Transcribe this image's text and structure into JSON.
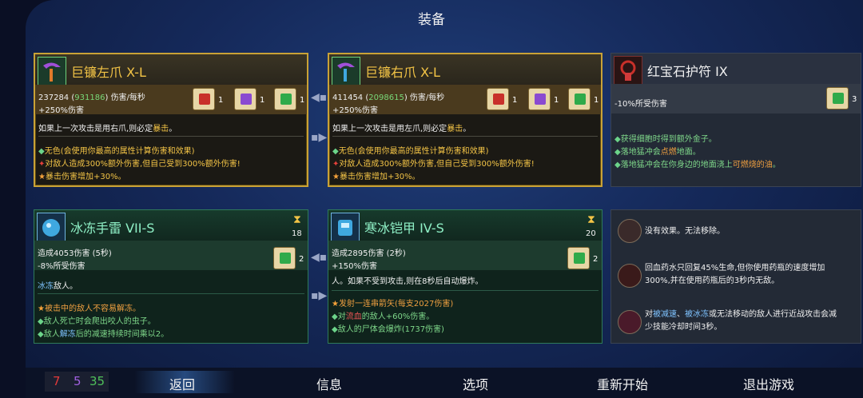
{
  "header": {
    "title": "装备"
  },
  "weapons": [
    {
      "name": "巨镰左爪 X-L",
      "dps": "237284",
      "dps_alt": "931186",
      "dps_unit": "伤害/每秒",
      "bonus": "+250%伤害",
      "scrolls": [
        {
          "icon": "brutality-scroll-icon",
          "count": "1",
          "color": "#c8302a"
        },
        {
          "icon": "tactics-scroll-icon",
          "count": "1",
          "color": "#8a4ad0"
        },
        {
          "icon": "survival-scroll-icon",
          "count": "1",
          "color": "#2faa4a"
        }
      ],
      "effect_prefix": "如果上一次攻击是用右爪,则必定",
      "effect_keyword": "暴击",
      "effect_suffix": "。",
      "affixes": [
        "无色(会使用你最高的属性计算伤害和效果)",
        "对敌人造成300%额外伤害,但自己受到300%额外伤害!",
        "暴击伤害增加+30%。"
      ]
    },
    {
      "name": "巨镰右爪 X-L",
      "dps": "411454",
      "dps_alt": "2098615",
      "dps_unit": "伤害/每秒",
      "bonus": "+250%伤害",
      "scrolls": [
        {
          "icon": "brutality-scroll-icon",
          "count": "1",
          "color": "#c8302a"
        },
        {
          "icon": "tactics-scroll-icon",
          "count": "1",
          "color": "#8a4ad0"
        },
        {
          "icon": "survival-scroll-icon",
          "count": "1",
          "color": "#2faa4a"
        }
      ],
      "effect_prefix": "如果上一次攻击是用左爪,则必定",
      "effect_keyword": "暴击",
      "effect_suffix": "。",
      "affixes": [
        "无色(会使用你最高的属性计算伤害和效果)",
        "对敌人造成300%额外伤害,但自己受到300%额外伤害!",
        "暴击伤害增加+30%。"
      ]
    }
  ],
  "amulet": {
    "name": "红宝石护符 IX",
    "stat": "-10%所受伤害",
    "scroll": {
      "icon": "survival-scroll-icon",
      "count": "3",
      "color": "#2faa4a"
    },
    "bullets": [
      {
        "a": "获得细胞时得到额外金子。"
      },
      {
        "a": "落地猛冲会",
        "b": "点燃",
        "c": "地面。"
      },
      {
        "a": "落地猛冲会在你身边的地面浇上",
        "b": "可燃烧的油",
        "c": "。"
      }
    ]
  },
  "skills": [
    {
      "name": "冰冻手雷 VII-S",
      "cooldown": "18",
      "stat1": "造成4053伤害 (5秒)",
      "stat2": "-8%所受伤害",
      "scroll": {
        "icon": "survival-scroll-icon",
        "count": "2",
        "color": "#2faa4a"
      },
      "effect_keyword": "冰冻",
      "effect_suffix": "敌人。",
      "affixes": [
        {
          "a": "被击中的敌人不容易解冻。"
        },
        {
          "a": "敌人死亡时会爬出咬人的虫子。"
        },
        {
          "a": "敌人",
          "b": "解冻",
          "c": "后的减速持续时间乘以2。"
        }
      ]
    },
    {
      "name": "寒冰铠甲 IV-S",
      "cooldown": "20",
      "stat1": "造成2895伤害 (2秒)",
      "stat2": "+150%伤害",
      "scroll": {
        "icon": "survival-scroll-icon",
        "count": "2",
        "color": "#2faa4a"
      },
      "effect_text": "人。如果不受到攻击,则在8秒后自动爆炸。",
      "affixes": [
        {
          "a": "发射一连串箭矢(每支2027伤害)"
        },
        {
          "a": "对",
          "b": "流血",
          "c": "的敌人+60%伤害。"
        },
        {
          "a": "敌人的尸体会爆炸(1737伤害)"
        }
      ]
    }
  ],
  "mutations": [
    {
      "icon": "no-effect-mutation-icon",
      "lines": [
        "没有效果。无法移除。"
      ]
    },
    {
      "icon": "potion-mutation-icon",
      "lines": [
        "回血药水只回复45%生命,但你使用药瓶的速度增加",
        "300%,并在使用药瓶后的3秒内无敌。"
      ]
    },
    {
      "icon": "slow-target-mutation-icon",
      "prefix": "对",
      "k1": "被减速",
      "mid": "、",
      "k2": "被冰冻",
      "rest": "或无法移动的敌人进行近战攻击会减",
      "line2": "少技能冷却时间3秒。"
    }
  ],
  "stats": {
    "brutality": "7",
    "tactics": "5",
    "survival": "35"
  },
  "nav": [
    "返回",
    "信息",
    "选项",
    "重新开始",
    "退出游戏"
  ]
}
